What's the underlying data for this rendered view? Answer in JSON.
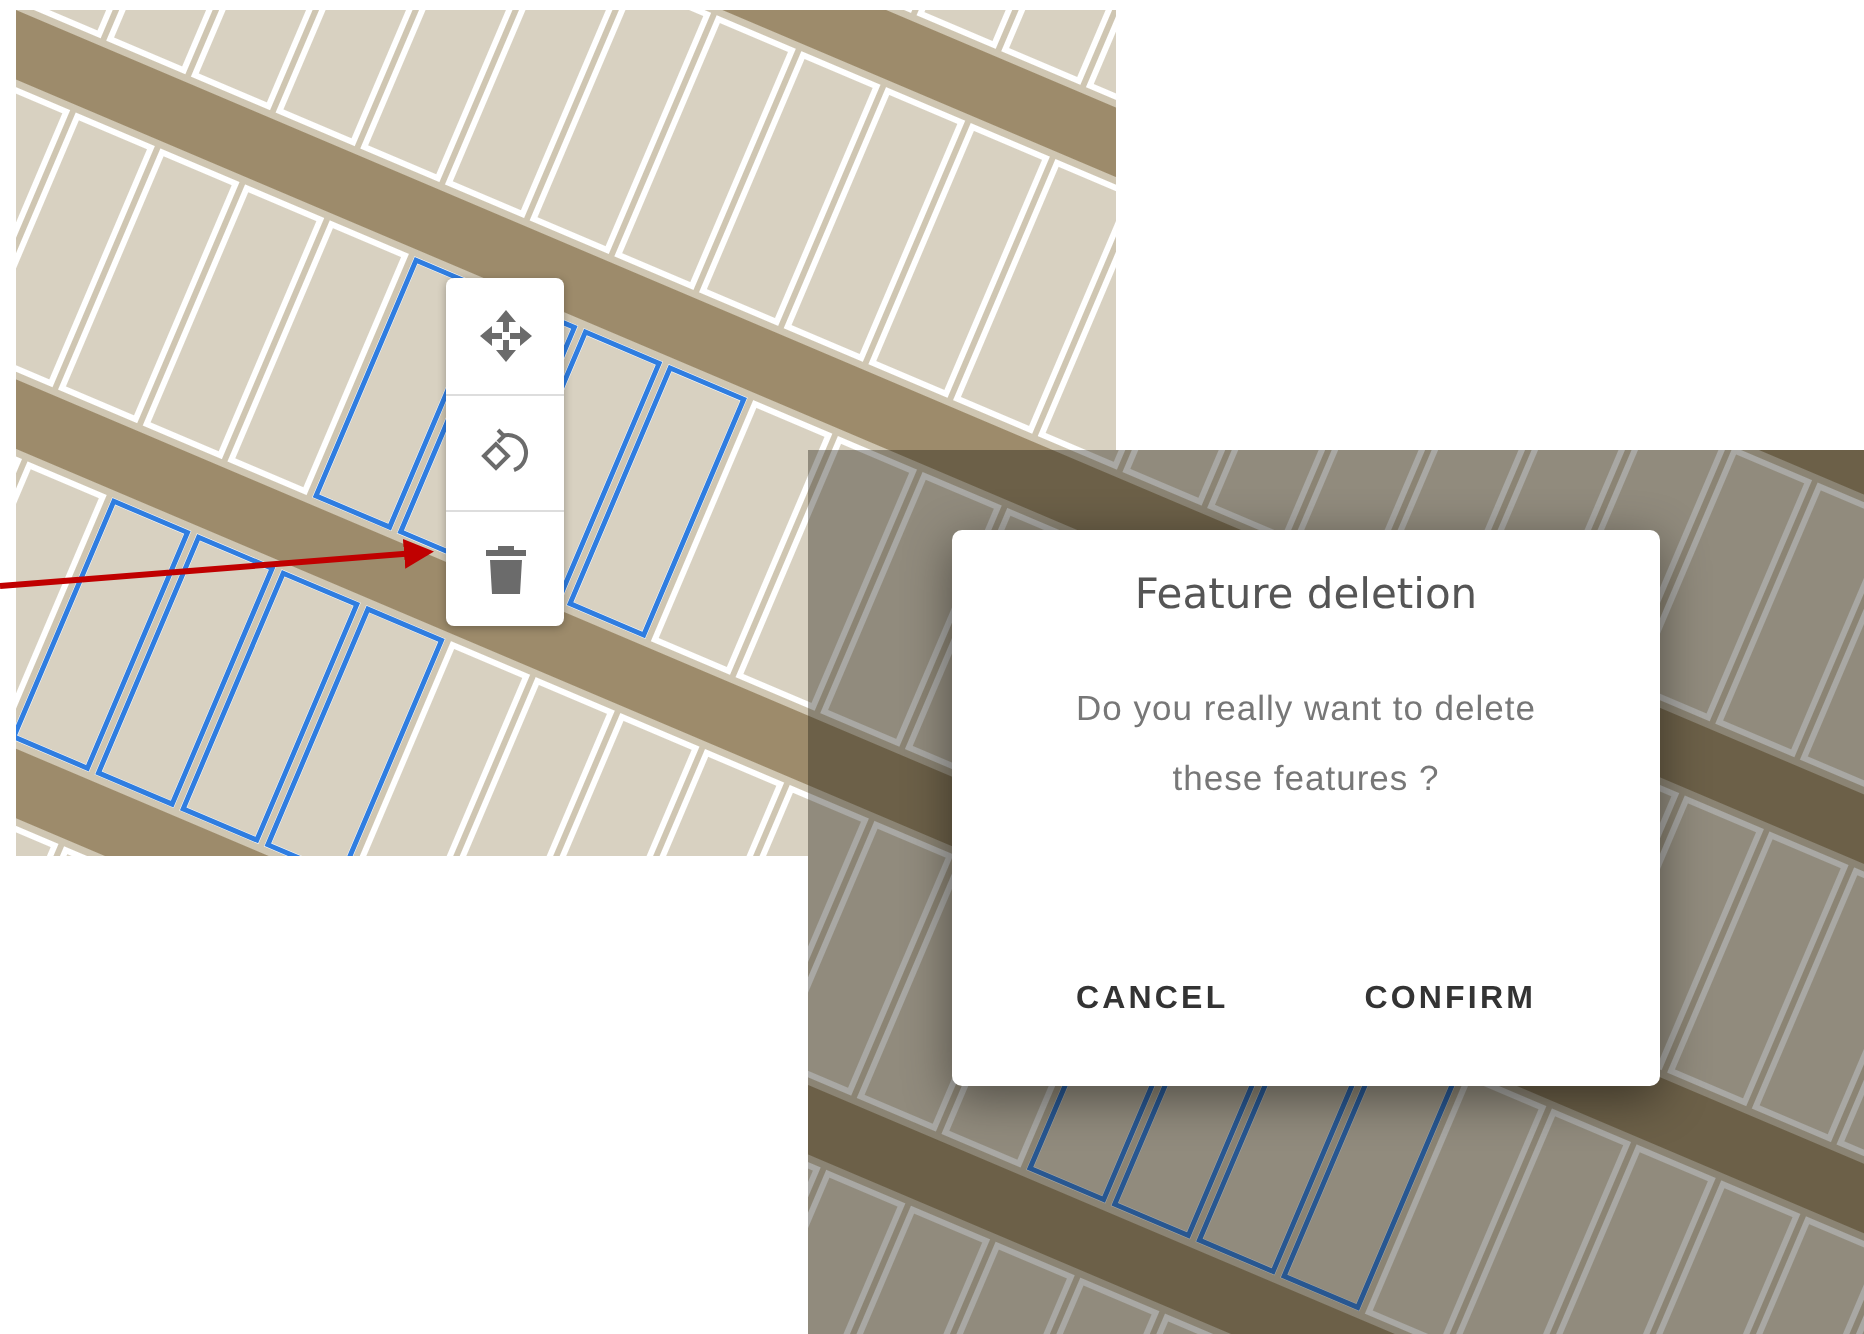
{
  "map_toolbar": {
    "tools": [
      {
        "kind": "move"
      },
      {
        "kind": "rotate"
      },
      {
        "kind": "delete"
      }
    ]
  },
  "dialog": {
    "title": "Feature deletion",
    "message": "Do you really want to delete these features ?",
    "buttons": [
      {
        "label": "CANCEL"
      },
      {
        "label": "CONFIRM"
      }
    ]
  }
}
